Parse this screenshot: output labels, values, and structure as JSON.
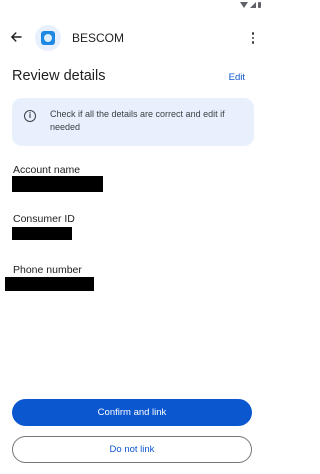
{
  "status_bar": {
    "icons": [
      "wifi-icon",
      "signal-icon",
      "battery-icon"
    ]
  },
  "app_bar": {
    "back_icon": "arrow-back-icon",
    "logo_icon": "besc-logo-icon",
    "title": "BESCOM",
    "more_icon": "more-vert-icon"
  },
  "header": {
    "title": "Review details",
    "edit_label": "Edit"
  },
  "info_card": {
    "icon": "info-icon",
    "text": "Check if all the details are correct and edit if needed"
  },
  "fields": {
    "account_name_label": "Account name",
    "consumer_id_label": "Consumer ID",
    "phone_number_label": "Phone number"
  },
  "actions": {
    "confirm_label": "Confirm and link",
    "decline_label": "Do not link"
  },
  "colors": {
    "primary": "#0b57d0",
    "info_bg": "#e8f0fe",
    "text": "#1f1f1f"
  }
}
